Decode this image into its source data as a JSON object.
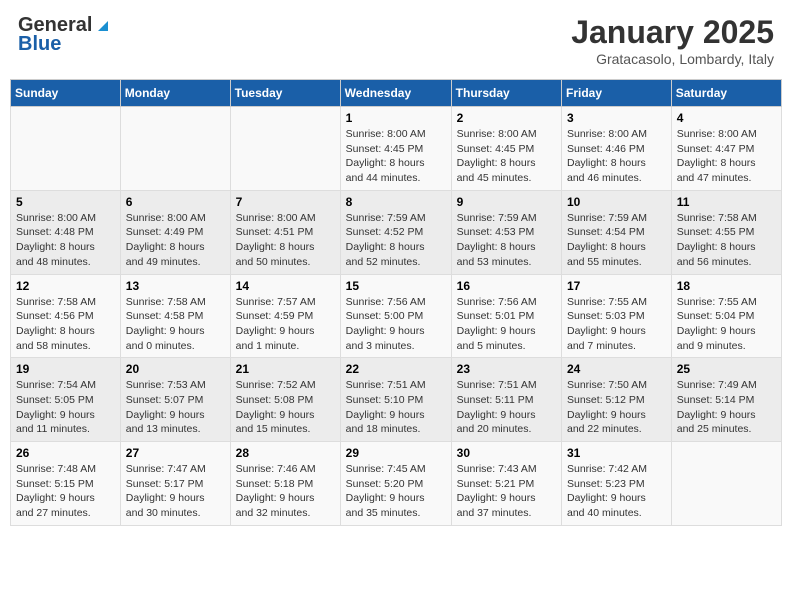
{
  "header": {
    "logo_general": "General",
    "logo_blue": "Blue",
    "month": "January 2025",
    "location": "Gratacasolo, Lombardy, Italy"
  },
  "weekdays": [
    "Sunday",
    "Monday",
    "Tuesday",
    "Wednesday",
    "Thursday",
    "Friday",
    "Saturday"
  ],
  "weeks": [
    [
      {
        "day": "",
        "info": ""
      },
      {
        "day": "",
        "info": ""
      },
      {
        "day": "",
        "info": ""
      },
      {
        "day": "1",
        "info": "Sunrise: 8:00 AM\nSunset: 4:45 PM\nDaylight: 8 hours\nand 44 minutes."
      },
      {
        "day": "2",
        "info": "Sunrise: 8:00 AM\nSunset: 4:45 PM\nDaylight: 8 hours\nand 45 minutes."
      },
      {
        "day": "3",
        "info": "Sunrise: 8:00 AM\nSunset: 4:46 PM\nDaylight: 8 hours\nand 46 minutes."
      },
      {
        "day": "4",
        "info": "Sunrise: 8:00 AM\nSunset: 4:47 PM\nDaylight: 8 hours\nand 47 minutes."
      }
    ],
    [
      {
        "day": "5",
        "info": "Sunrise: 8:00 AM\nSunset: 4:48 PM\nDaylight: 8 hours\nand 48 minutes."
      },
      {
        "day": "6",
        "info": "Sunrise: 8:00 AM\nSunset: 4:49 PM\nDaylight: 8 hours\nand 49 minutes."
      },
      {
        "day": "7",
        "info": "Sunrise: 8:00 AM\nSunset: 4:51 PM\nDaylight: 8 hours\nand 50 minutes."
      },
      {
        "day": "8",
        "info": "Sunrise: 7:59 AM\nSunset: 4:52 PM\nDaylight: 8 hours\nand 52 minutes."
      },
      {
        "day": "9",
        "info": "Sunrise: 7:59 AM\nSunset: 4:53 PM\nDaylight: 8 hours\nand 53 minutes."
      },
      {
        "day": "10",
        "info": "Sunrise: 7:59 AM\nSunset: 4:54 PM\nDaylight: 8 hours\nand 55 minutes."
      },
      {
        "day": "11",
        "info": "Sunrise: 7:58 AM\nSunset: 4:55 PM\nDaylight: 8 hours\nand 56 minutes."
      }
    ],
    [
      {
        "day": "12",
        "info": "Sunrise: 7:58 AM\nSunset: 4:56 PM\nDaylight: 8 hours\nand 58 minutes."
      },
      {
        "day": "13",
        "info": "Sunrise: 7:58 AM\nSunset: 4:58 PM\nDaylight: 9 hours\nand 0 minutes."
      },
      {
        "day": "14",
        "info": "Sunrise: 7:57 AM\nSunset: 4:59 PM\nDaylight: 9 hours\nand 1 minute."
      },
      {
        "day": "15",
        "info": "Sunrise: 7:56 AM\nSunset: 5:00 PM\nDaylight: 9 hours\nand 3 minutes."
      },
      {
        "day": "16",
        "info": "Sunrise: 7:56 AM\nSunset: 5:01 PM\nDaylight: 9 hours\nand 5 minutes."
      },
      {
        "day": "17",
        "info": "Sunrise: 7:55 AM\nSunset: 5:03 PM\nDaylight: 9 hours\nand 7 minutes."
      },
      {
        "day": "18",
        "info": "Sunrise: 7:55 AM\nSunset: 5:04 PM\nDaylight: 9 hours\nand 9 minutes."
      }
    ],
    [
      {
        "day": "19",
        "info": "Sunrise: 7:54 AM\nSunset: 5:05 PM\nDaylight: 9 hours\nand 11 minutes."
      },
      {
        "day": "20",
        "info": "Sunrise: 7:53 AM\nSunset: 5:07 PM\nDaylight: 9 hours\nand 13 minutes."
      },
      {
        "day": "21",
        "info": "Sunrise: 7:52 AM\nSunset: 5:08 PM\nDaylight: 9 hours\nand 15 minutes."
      },
      {
        "day": "22",
        "info": "Sunrise: 7:51 AM\nSunset: 5:10 PM\nDaylight: 9 hours\nand 18 minutes."
      },
      {
        "day": "23",
        "info": "Sunrise: 7:51 AM\nSunset: 5:11 PM\nDaylight: 9 hours\nand 20 minutes."
      },
      {
        "day": "24",
        "info": "Sunrise: 7:50 AM\nSunset: 5:12 PM\nDaylight: 9 hours\nand 22 minutes."
      },
      {
        "day": "25",
        "info": "Sunrise: 7:49 AM\nSunset: 5:14 PM\nDaylight: 9 hours\nand 25 minutes."
      }
    ],
    [
      {
        "day": "26",
        "info": "Sunrise: 7:48 AM\nSunset: 5:15 PM\nDaylight: 9 hours\nand 27 minutes."
      },
      {
        "day": "27",
        "info": "Sunrise: 7:47 AM\nSunset: 5:17 PM\nDaylight: 9 hours\nand 30 minutes."
      },
      {
        "day": "28",
        "info": "Sunrise: 7:46 AM\nSunset: 5:18 PM\nDaylight: 9 hours\nand 32 minutes."
      },
      {
        "day": "29",
        "info": "Sunrise: 7:45 AM\nSunset: 5:20 PM\nDaylight: 9 hours\nand 35 minutes."
      },
      {
        "day": "30",
        "info": "Sunrise: 7:43 AM\nSunset: 5:21 PM\nDaylight: 9 hours\nand 37 minutes."
      },
      {
        "day": "31",
        "info": "Sunrise: 7:42 AM\nSunset: 5:23 PM\nDaylight: 9 hours\nand 40 minutes."
      },
      {
        "day": "",
        "info": ""
      }
    ]
  ]
}
